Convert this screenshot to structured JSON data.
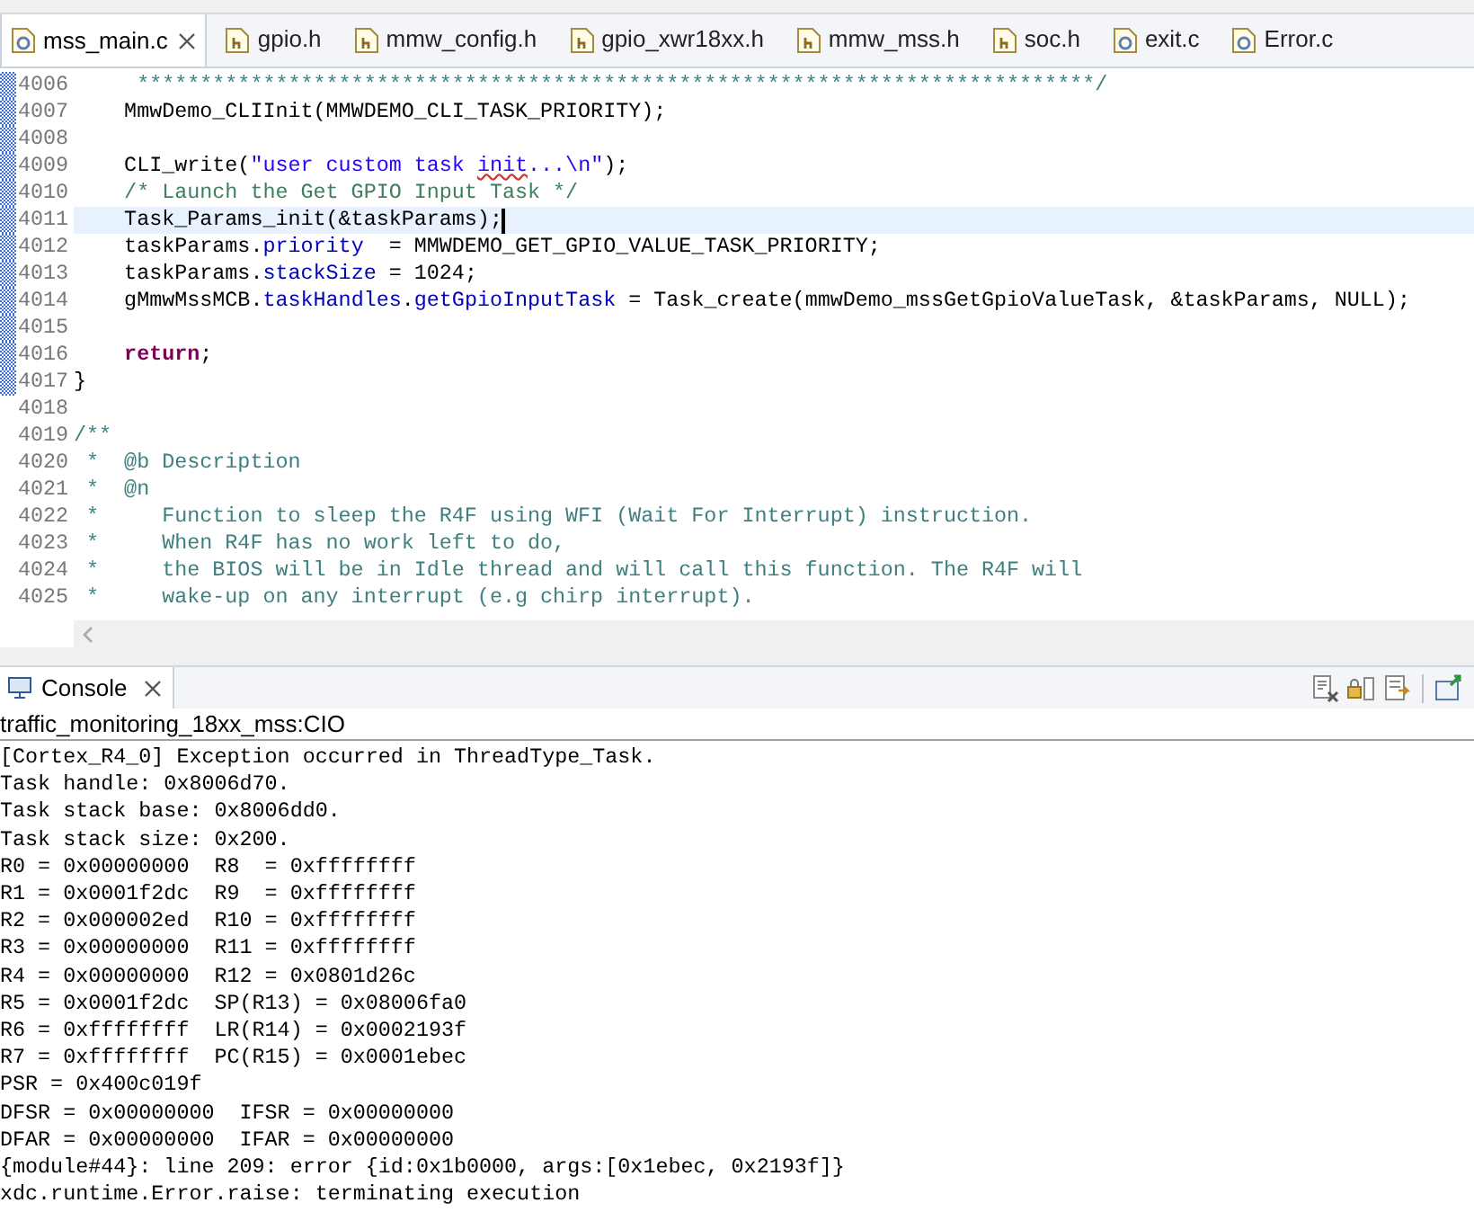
{
  "editor": {
    "tabs": [
      {
        "label": "mss_main.c",
        "kind": "c",
        "selected": true
      },
      {
        "label": "gpio.h",
        "kind": "h",
        "selected": false
      },
      {
        "label": "mmw_config.h",
        "kind": "h",
        "selected": false
      },
      {
        "label": "gpio_xwr18xx.h",
        "kind": "h",
        "selected": false
      },
      {
        "label": "mmw_mss.h",
        "kind": "h",
        "selected": false
      },
      {
        "label": "soc.h",
        "kind": "h",
        "selected": false
      },
      {
        "label": "exit.c",
        "kind": "c",
        "selected": false
      },
      {
        "label": "Error.c",
        "kind": "c",
        "selected": false
      }
    ],
    "lines": [
      {
        "number": "4006",
        "changed": true,
        "current": false,
        "tokens": [
          {
            "kind": "doc",
            "text": "     ****************************************************************************/"
          }
        ]
      },
      {
        "number": "4007",
        "changed": true,
        "current": false,
        "tokens": [
          {
            "kind": "plain",
            "text": "    MmwDemo_CLIInit(MMWDEMO_CLI_TASK_PRIORITY);"
          }
        ]
      },
      {
        "number": "4008",
        "changed": true,
        "current": false
      },
      {
        "number": "4009",
        "changed": true,
        "current": false,
        "tokens": [
          {
            "kind": "plain",
            "text": "    CLI_write("
          },
          {
            "kind": "string",
            "text": "\"user custom task "
          },
          {
            "kind": "typo",
            "text": "init"
          },
          {
            "kind": "string",
            "text": "...\\n\""
          },
          {
            "kind": "plain",
            "text": ");"
          }
        ]
      },
      {
        "number": "4010",
        "changed": true,
        "current": false,
        "tokens": [
          {
            "kind": "comment",
            "text": "    /* Launch the Get GPIO Input Task */"
          }
        ]
      },
      {
        "number": "4011",
        "changed": true,
        "current": true,
        "tokens": [
          {
            "kind": "plain",
            "text": "    Task_Params_init(&taskParams);"
          }
        ]
      },
      {
        "number": "4012",
        "changed": true,
        "current": false,
        "tokens": [
          {
            "kind": "plain",
            "text": "    taskParams."
          },
          {
            "kind": "field",
            "text": "priority"
          },
          {
            "kind": "plain",
            "text": "  = MMWDEMO_GET_GPIO_VALUE_TASK_PRIORITY;"
          }
        ]
      },
      {
        "number": "4013",
        "changed": true,
        "current": false,
        "tokens": [
          {
            "kind": "plain",
            "text": "    taskParams."
          },
          {
            "kind": "field",
            "text": "stackSize"
          },
          {
            "kind": "plain",
            "text": " = 1024;"
          }
        ]
      },
      {
        "number": "4014",
        "changed": true,
        "current": false,
        "tokens": [
          {
            "kind": "plain",
            "text": "    gMmwMssMCB."
          },
          {
            "kind": "field",
            "text": "taskHandles"
          },
          {
            "kind": "plain",
            "text": "."
          },
          {
            "kind": "field",
            "text": "getGpioInputTask"
          },
          {
            "kind": "plain",
            "text": " = Task_create(mmwDemo_mssGetGpioValueTask, &taskParams, NULL);"
          }
        ]
      },
      {
        "number": "4015",
        "changed": true,
        "current": false
      },
      {
        "number": "4016",
        "changed": true,
        "current": false,
        "tokens": [
          {
            "kind": "keyword",
            "text": "    return"
          },
          {
            "kind": "plain",
            "text": ";"
          }
        ]
      },
      {
        "number": "4017",
        "changed": true,
        "current": false,
        "tokens": [
          {
            "kind": "plain",
            "text": "}"
          }
        ]
      },
      {
        "number": "4018",
        "changed": false,
        "current": false
      },
      {
        "number": "4019",
        "changed": false,
        "current": false,
        "tokens": [
          {
            "kind": "doc",
            "text": "/**"
          }
        ]
      },
      {
        "number": "4020",
        "changed": false,
        "current": false,
        "tokens": [
          {
            "kind": "doc",
            "text": " *  @b Description"
          }
        ]
      },
      {
        "number": "4021",
        "changed": false,
        "current": false,
        "tokens": [
          {
            "kind": "doc",
            "text": " *  @n"
          }
        ]
      },
      {
        "number": "4022",
        "changed": false,
        "current": false,
        "tokens": [
          {
            "kind": "doc",
            "text": " *     Function to sleep the R4F using WFI (Wait For Interrupt) instruction."
          }
        ]
      },
      {
        "number": "4023",
        "changed": false,
        "current": false,
        "tokens": [
          {
            "kind": "doc",
            "text": " *     When R4F has no work left to do,"
          }
        ]
      },
      {
        "number": "4024",
        "changed": false,
        "current": false,
        "tokens": [
          {
            "kind": "doc",
            "text": " *     the BIOS will be in Idle thread and will call this function. The R4F will"
          }
        ]
      },
      {
        "number": "4025",
        "changed": false,
        "current": false,
        "tokens": [
          {
            "kind": "doc",
            "text": " *     wake-up on any interrupt (e.g chirp interrupt)."
          }
        ]
      }
    ]
  },
  "console": {
    "tab": {
      "label": "Console",
      "selected": true
    },
    "title": "traffic_monitoring_18xx_mss:CIO",
    "lines": [
      "[Cortex_R4_0] Exception occurred in ThreadType_Task.",
      "Task handle: 0x8006d70.",
      "Task stack base: 0x8006dd0.",
      "Task stack size: 0x200.",
      "R0 = 0x00000000  R8  = 0xffffffff",
      "R1 = 0x0001f2dc  R9  = 0xffffffff",
      "R2 = 0x000002ed  R10 = 0xffffffff",
      "R3 = 0x00000000  R11 = 0xffffffff",
      "R4 = 0x00000000  R12 = 0x0801d26c",
      "R5 = 0x0001f2dc  SP(R13) = 0x08006fa0",
      "R6 = 0xffffffff  LR(R14) = 0x0002193f",
      "R7 = 0xffffffff  PC(R15) = 0x0001ebec",
      "PSR = 0x400c019f",
      "DFSR = 0x00000000  IFSR = 0x00000000",
      "DFAR = 0x00000000  IFAR = 0x00000000",
      "{module#44}: line 209: error {id:0x1b0000, args:[0x1ebec, 0x2193f]}",
      "xdc.runtime.Error.raise: terminating execution"
    ]
  }
}
